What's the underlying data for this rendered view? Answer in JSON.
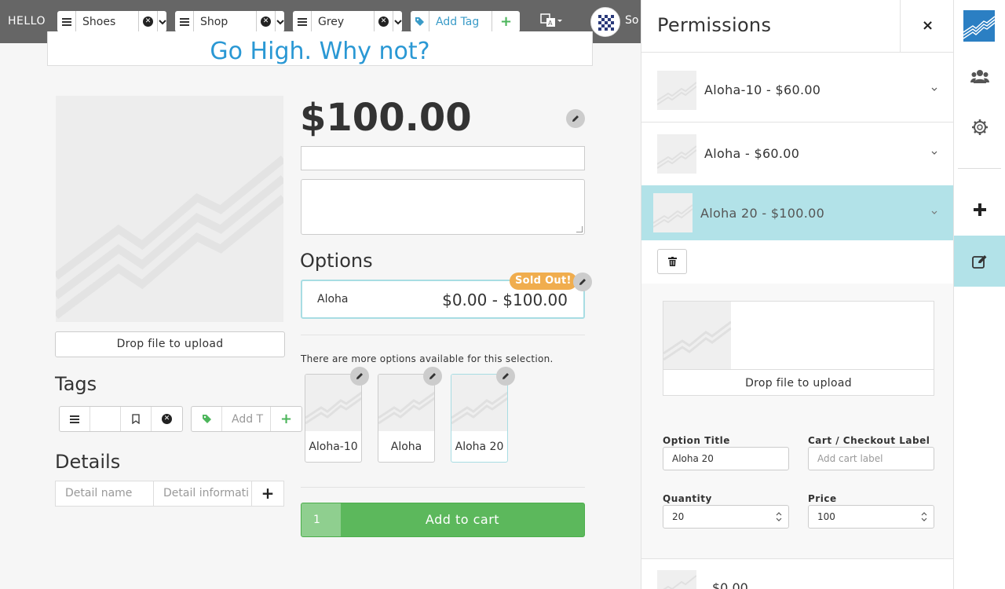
{
  "topbar": {
    "greeting": "HELLO",
    "filters": [
      {
        "label": "Shoes"
      },
      {
        "label": "Shop"
      },
      {
        "label": "Grey"
      }
    ],
    "add_tag": "Add Tag",
    "user_initials": "So"
  },
  "product": {
    "headline": "Go High. Why not?",
    "price": "$100.00",
    "drop_label": "Drop file to upload",
    "tags_heading": "Tags",
    "tag_input_placeholder": "Add T",
    "details_heading": "Details",
    "detail_name_placeholder": "Detail name",
    "detail_info_placeholder": "Detail informati",
    "options_heading": "Options",
    "option": {
      "name": "Aloha",
      "range": "$0.00 - $100.00",
      "badge": "Sold Out!"
    },
    "more_options_note": "There are more options available for this selection.",
    "variants": [
      {
        "label": "Aloha-10"
      },
      {
        "label": "Aloha"
      },
      {
        "label": "Aloha 20"
      }
    ],
    "cart": {
      "quantity": "1",
      "label": "Add to cart"
    }
  },
  "permissions": {
    "title": "Permissions",
    "close": "×",
    "items": [
      {
        "label": "Aloha-10 - $60.00"
      },
      {
        "label": "Aloha - $60.00"
      },
      {
        "label": "Aloha 20 - $100.00"
      }
    ],
    "editor": {
      "drop_label": "Drop file to upload",
      "option_title_label": "Option Title",
      "option_title_value": "Aloha 20",
      "cart_label_label": "Cart / Checkout Label",
      "cart_label_placeholder": "Add cart label",
      "quantity_label": "Quantity",
      "quantity_value": "20",
      "price_label": "Price",
      "price_value": "100"
    },
    "next_item_label": "$0.00"
  },
  "colors": {
    "topbar": "#666666",
    "accent_blue": "#2a98d4",
    "selected_teal": "#b2e2e8",
    "cart_green": "#5cb85c",
    "sold_out_orange": "#f0ad4e"
  }
}
